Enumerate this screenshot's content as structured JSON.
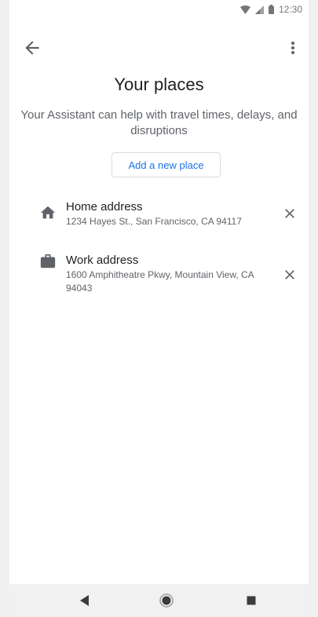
{
  "status_bar": {
    "time": "12:30",
    "icons": [
      "wifi-icon",
      "signal-icon",
      "battery-icon"
    ]
  },
  "app_bar": {
    "back_icon": "arrow-back-icon",
    "menu_icon": "more-vert-icon"
  },
  "main": {
    "title": "Your places",
    "subtitle": "Your Assistant can help with travel times, delays, and disruptions",
    "add_button_label": "Add a new place"
  },
  "places": [
    {
      "icon": "home-icon",
      "title": "Home address",
      "address": "1234 Hayes St., San Francisco, CA 94117"
    },
    {
      "icon": "briefcase-icon",
      "title": "Work address",
      "address": "1600 Amphitheatre Pkwy, Mountain View, CA 94043"
    }
  ],
  "nav_bar": {
    "icons": [
      "back-triangle-icon",
      "home-circle-icon",
      "recents-square-icon"
    ]
  },
  "colors": {
    "accent": "#1a73e8",
    "text_primary": "#202124",
    "text_secondary": "#5f6368",
    "icon": "#5f6368"
  }
}
